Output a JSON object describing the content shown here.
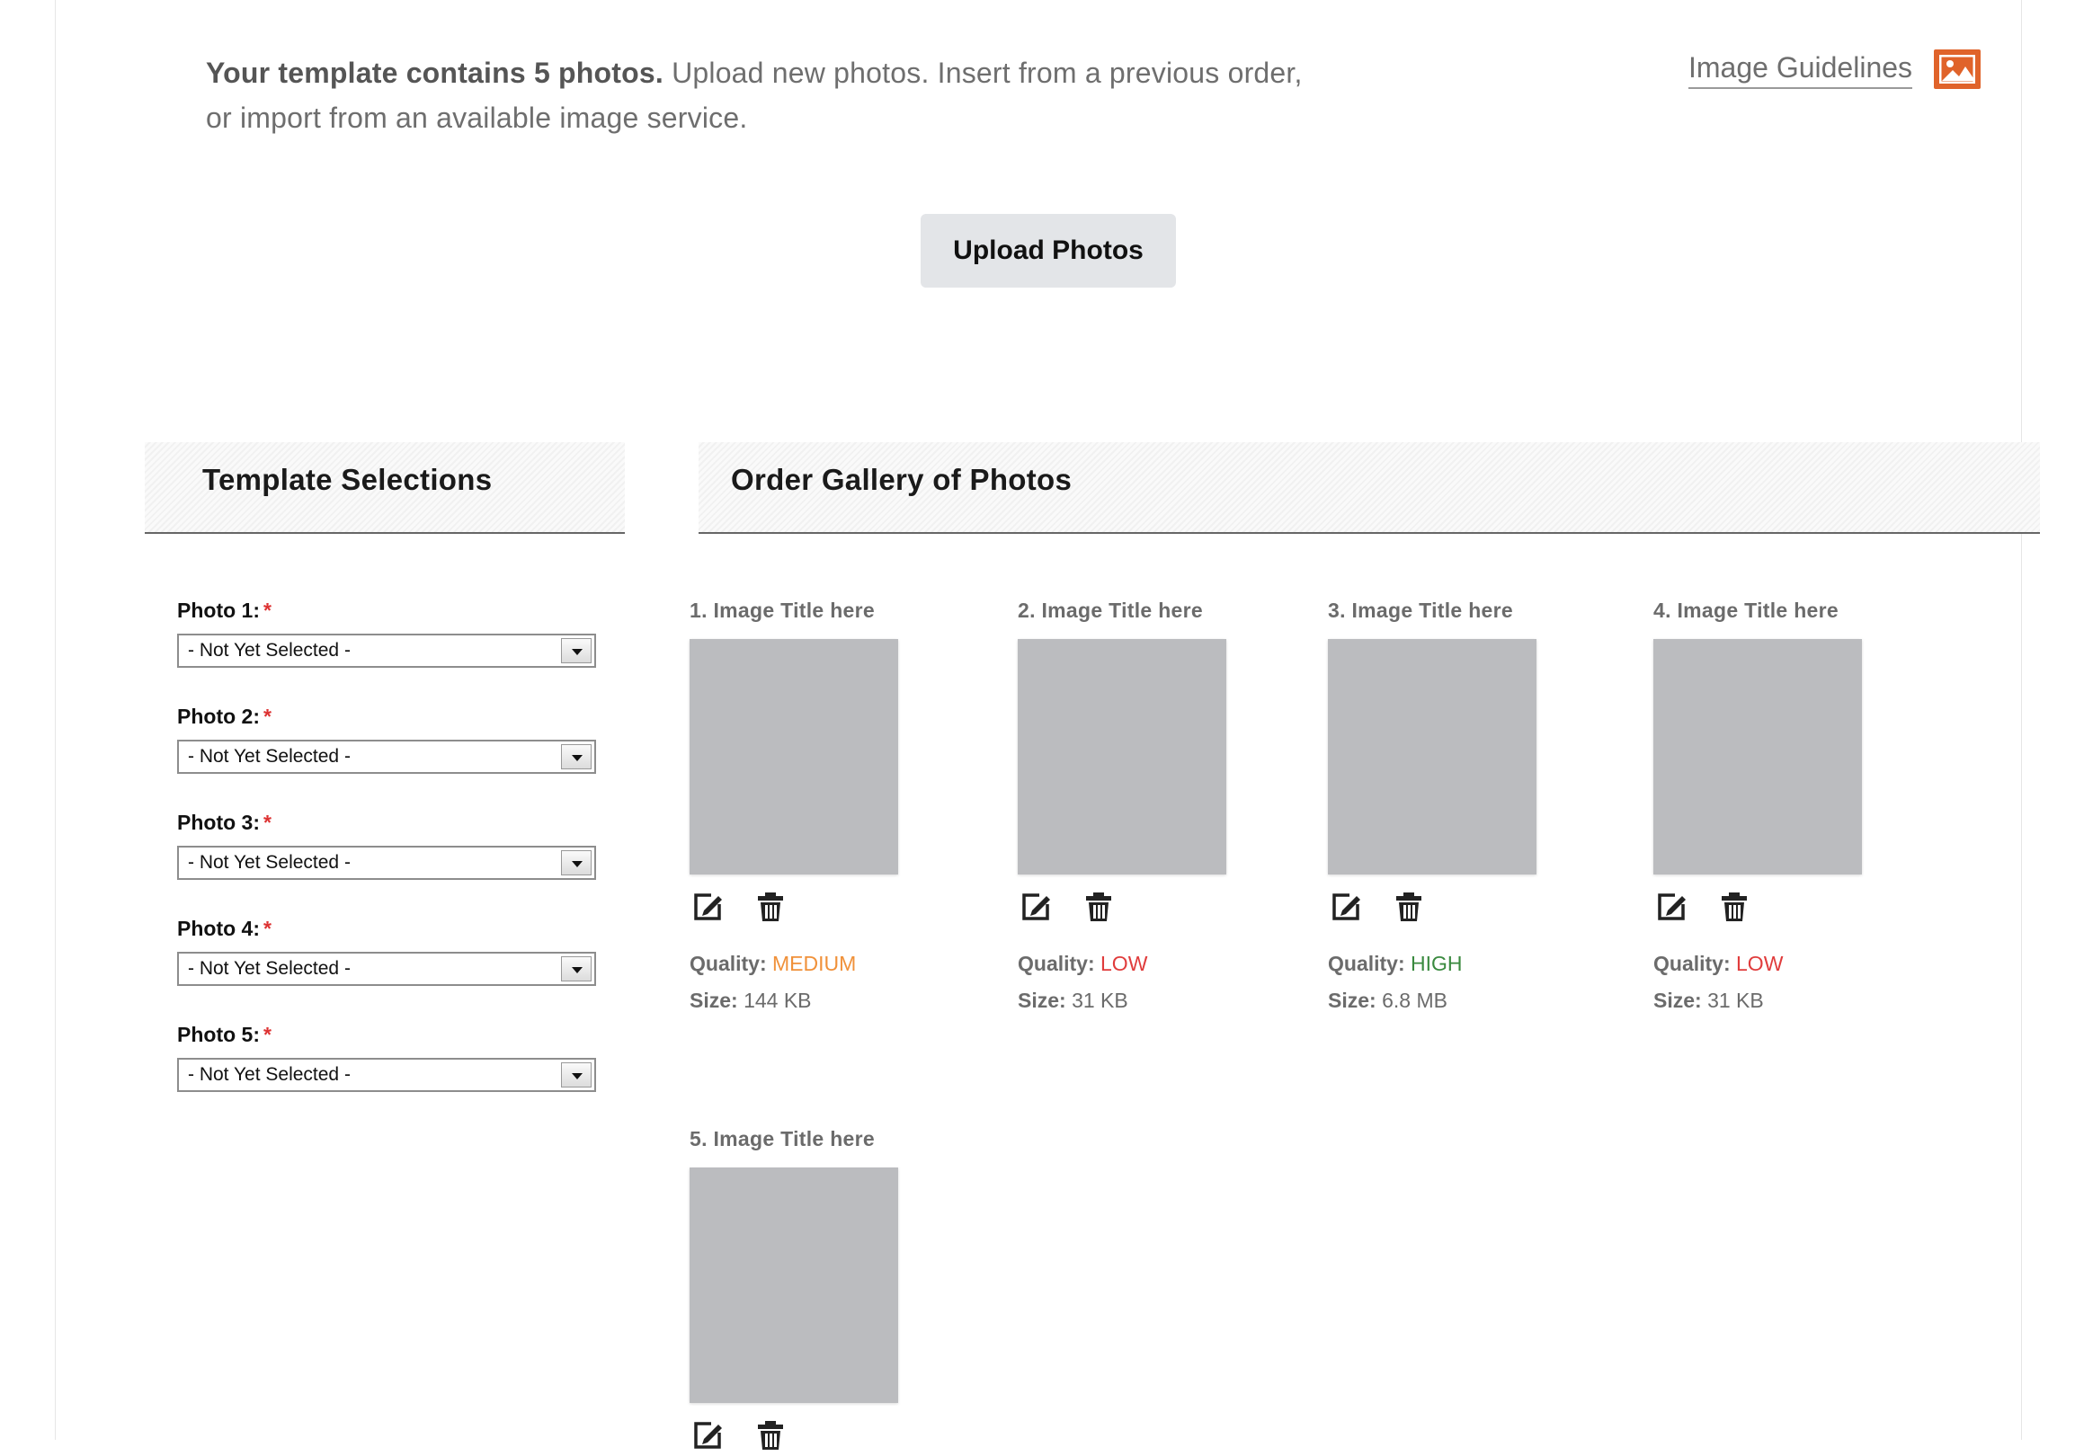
{
  "intro": {
    "bold": "Your template contains 5 photos.",
    "line1_rest": " Upload new photos. Insert from a previous order,",
    "line2": "or import from an available image service."
  },
  "guidelines": {
    "label": "Image Guidelines",
    "icon": "image-icon",
    "icon_color": "#e0632a"
  },
  "upload_button": {
    "label": "Upload Photos"
  },
  "template_selections": {
    "title": "Template Selections",
    "fields": [
      {
        "label": "Photo 1:",
        "required": "*",
        "value": "- Not Yet Selected -"
      },
      {
        "label": "Photo 2:",
        "required": "*",
        "value": "- Not Yet Selected -"
      },
      {
        "label": "Photo 3:",
        "required": "*",
        "value": "- Not Yet Selected -"
      },
      {
        "label": "Photo 4:",
        "required": "*",
        "value": "- Not Yet Selected -"
      },
      {
        "label": "Photo 5:",
        "required": "*",
        "value": "- Not Yet Selected -"
      }
    ]
  },
  "gallery": {
    "title": "Order Gallery of Photos",
    "quality_label": "Quality:",
    "size_label": "Size:",
    "quality_colors": {
      "MEDIUM": "#f0913a",
      "LOW": "#e03c3c",
      "HIGH": "#3a8a3f"
    },
    "items": [
      {
        "title": "1. Image Title here",
        "quality": "MEDIUM",
        "size": "144 KB"
      },
      {
        "title": "2. Image Title here",
        "quality": "LOW",
        "size": "31 KB"
      },
      {
        "title": "3. Image Title here",
        "quality": "HIGH",
        "size": "6.8 MB"
      },
      {
        "title": "4. Image Title here",
        "quality": "LOW",
        "size": "31 KB"
      },
      {
        "title": "5. Image Title here",
        "quality": "",
        "size": ""
      }
    ]
  }
}
